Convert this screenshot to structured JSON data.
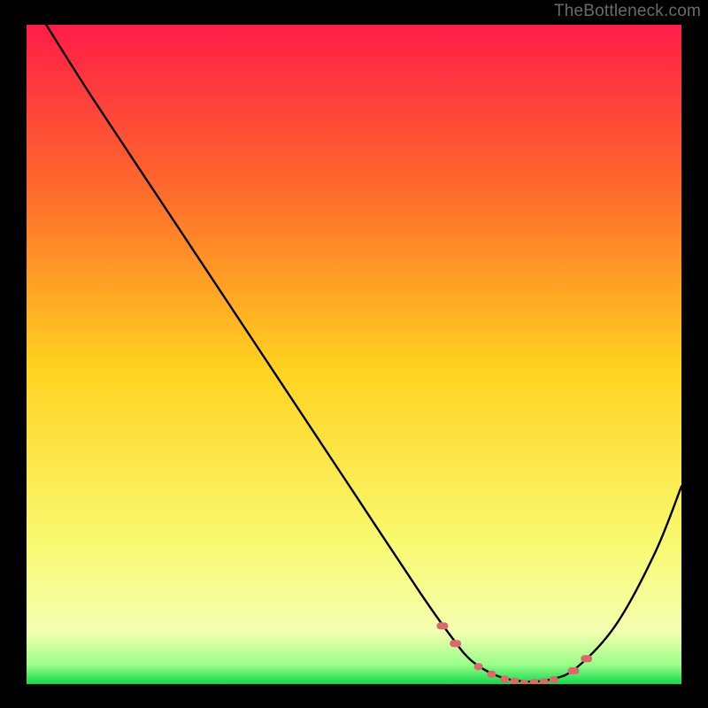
{
  "watermark": "TheBottleneck.com",
  "chart_data": {
    "type": "line",
    "title": "",
    "xlabel": "",
    "ylabel": "",
    "xlim": [
      0,
      100
    ],
    "ylim": [
      0,
      100
    ],
    "series": [
      {
        "name": "curve",
        "x": [
          3,
          10,
          20,
          30,
          40,
          50,
          60,
          65,
          68,
          72,
          76,
          80,
          84,
          90,
          96,
          100
        ],
        "y": [
          100,
          89,
          74,
          59,
          44,
          29,
          14,
          7,
          3.5,
          1.2,
          0.4,
          0.7,
          2.5,
          9,
          20,
          30
        ]
      }
    ],
    "highlight_band": {
      "x_start": 63,
      "x_end": 85,
      "note": "flat low region marked with red dashed dots"
    },
    "gradient_stops": [
      {
        "pct": 0,
        "color": "#ff1d48"
      },
      {
        "pct": 25,
        "color": "#ff6a2c"
      },
      {
        "pct": 52,
        "color": "#ffd21f"
      },
      {
        "pct": 78,
        "color": "#f9f96e"
      },
      {
        "pct": 92,
        "color": "#f4ffb0"
      },
      {
        "pct": 97,
        "color": "#9bff8a"
      },
      {
        "pct": 100,
        "color": "#13d74c"
      }
    ]
  }
}
